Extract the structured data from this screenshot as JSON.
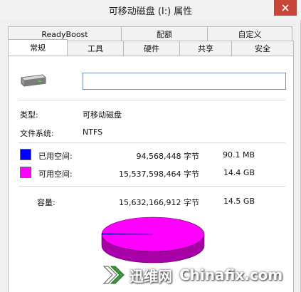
{
  "window": {
    "title": "可移动磁盘 (I:) 属性",
    "close_symbol": "×"
  },
  "tabs": {
    "back_row": [
      {
        "label": "ReadyBoost"
      },
      {
        "label": "配额"
      },
      {
        "label": "自定义"
      }
    ],
    "front_row": [
      {
        "label": "常规",
        "active": true
      },
      {
        "label": "工具"
      },
      {
        "label": "硬件"
      },
      {
        "label": "共享"
      },
      {
        "label": "安全"
      }
    ]
  },
  "general": {
    "drive_icon": "usb-drive-icon",
    "name_value": "",
    "type_label": "类型:",
    "type_value": "可移动磁盘",
    "fs_label": "文件系统:",
    "fs_value": "NTFS",
    "used": {
      "label": "已用空间:",
      "bytes": "94,568,448 字节",
      "size": "90.1 MB",
      "color": "#0000ff"
    },
    "free": {
      "label": "可用空间:",
      "bytes": "15,537,598,464 字节",
      "size": "14.4 GB",
      "color": "#ff00ff"
    },
    "capacity": {
      "label": "容量:",
      "bytes": "15,632,166,912 字节",
      "size": "14.5 GB"
    },
    "pie": {
      "used_bytes": 94568448,
      "free_bytes": 15537598464
    }
  },
  "watermark": {
    "cn_text": "迅维网",
    "en_text": "Chinafix.com"
  }
}
